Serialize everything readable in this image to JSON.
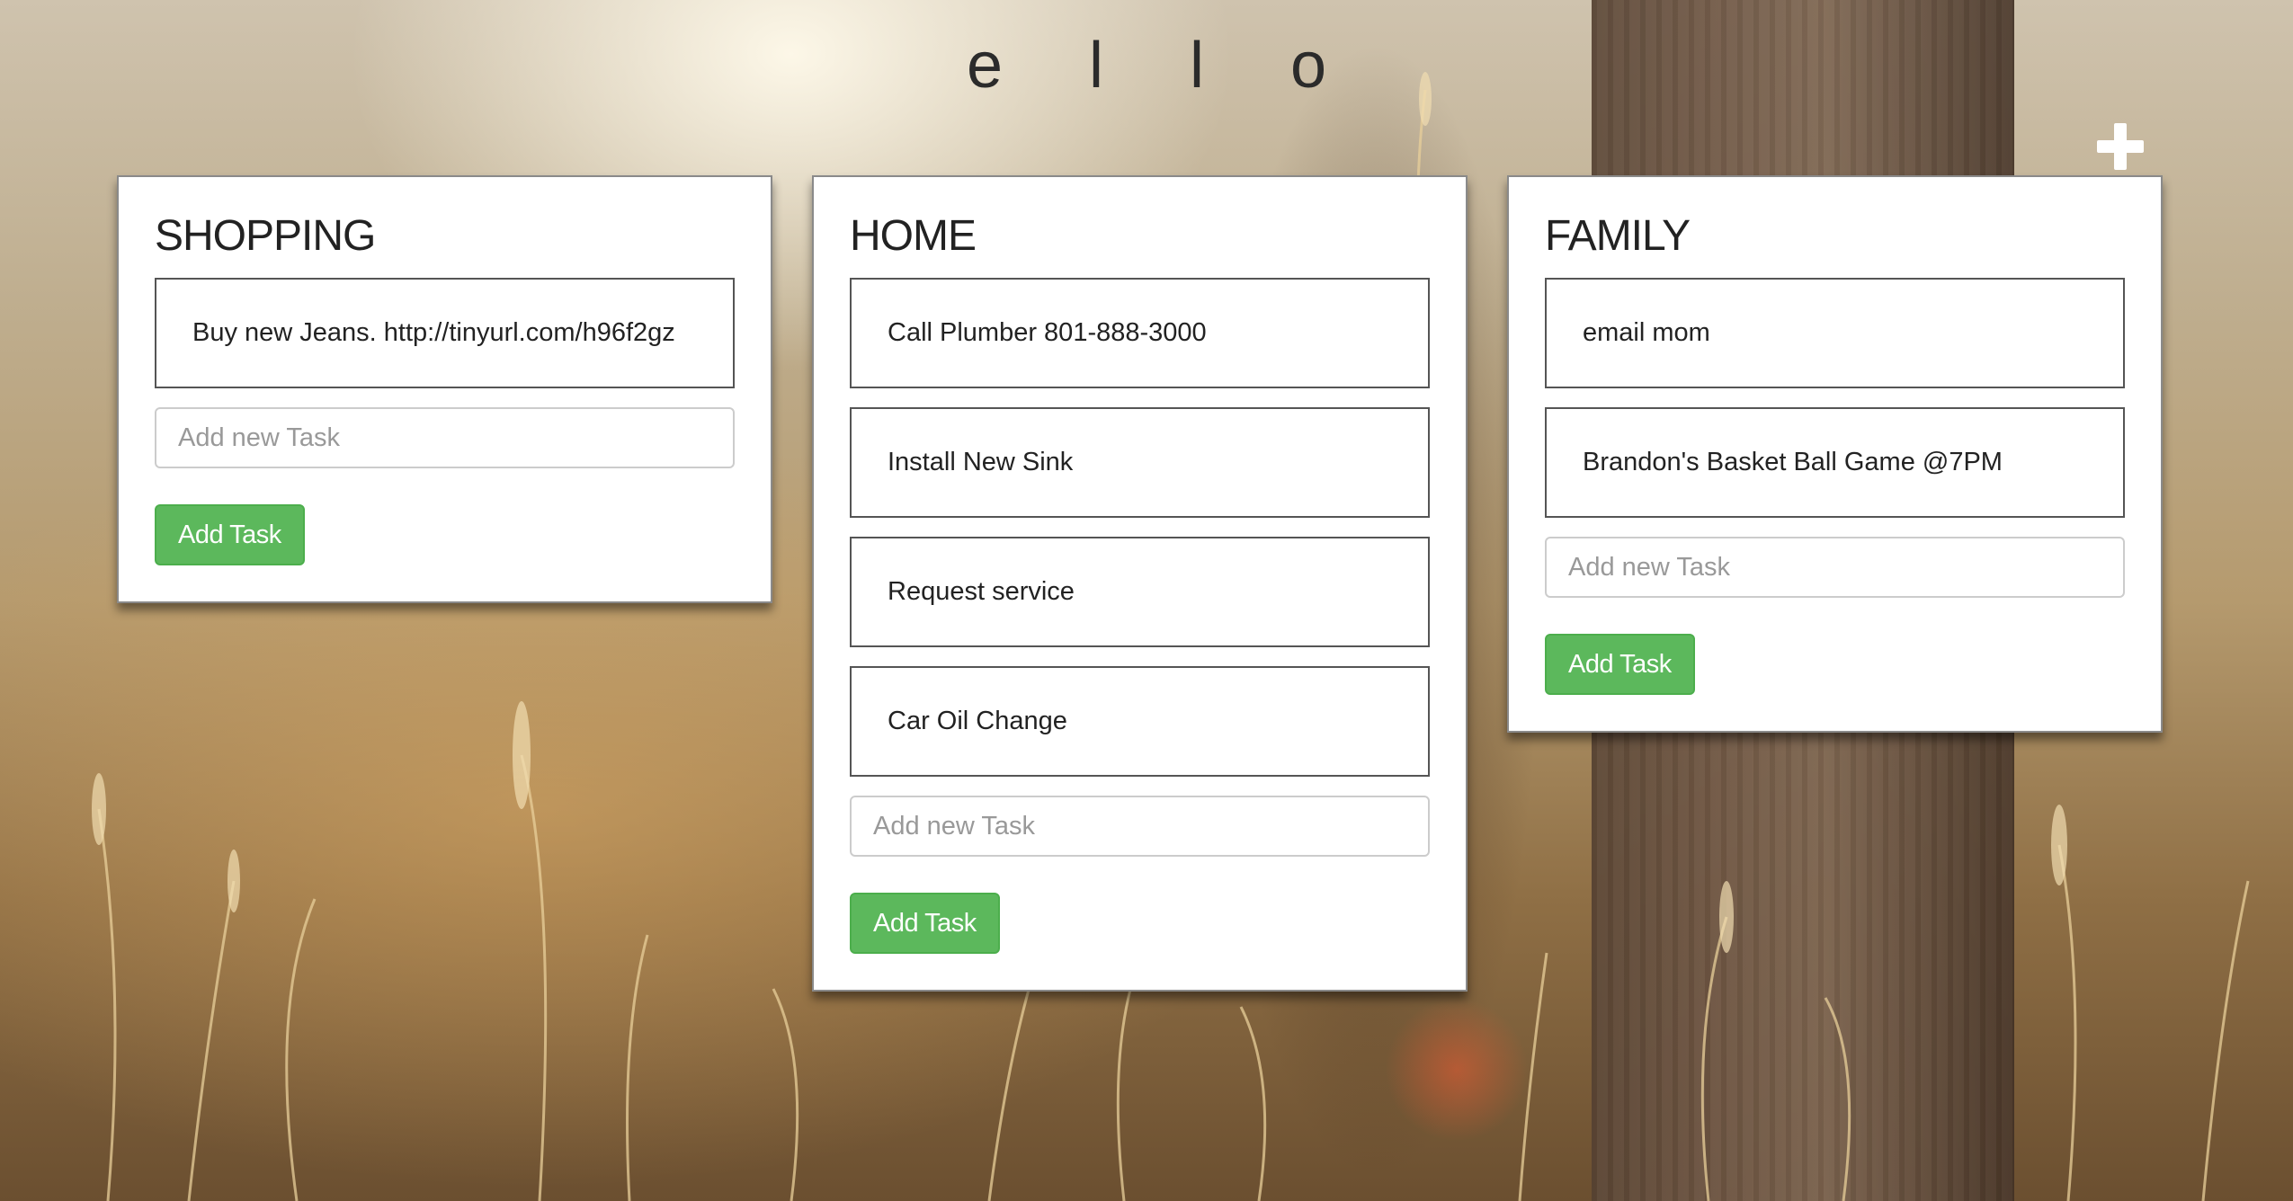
{
  "app": {
    "title": "e l l o"
  },
  "add_list_icon": "plus-icon",
  "accent_color": "#5cb85c",
  "lists": [
    {
      "title": "SHOPPING",
      "tasks": [
        "Buy new Jeans. http://tinyurl.com/h96f2gz"
      ],
      "input_placeholder": "Add new Task",
      "input_value": "",
      "button_label": "Add Task"
    },
    {
      "title": "HOME",
      "tasks": [
        "Call Plumber 801-888-3000",
        "Install New Sink",
        "Request service",
        "Car Oil Change"
      ],
      "input_placeholder": "Add new Task",
      "input_value": "",
      "button_label": "Add Task"
    },
    {
      "title": "FAMILY",
      "tasks": [
        "email mom",
        "Brandon's Basket Ball Game @7PM"
      ],
      "input_placeholder": "Add new Task",
      "input_value": "",
      "button_label": "Add Task"
    }
  ]
}
